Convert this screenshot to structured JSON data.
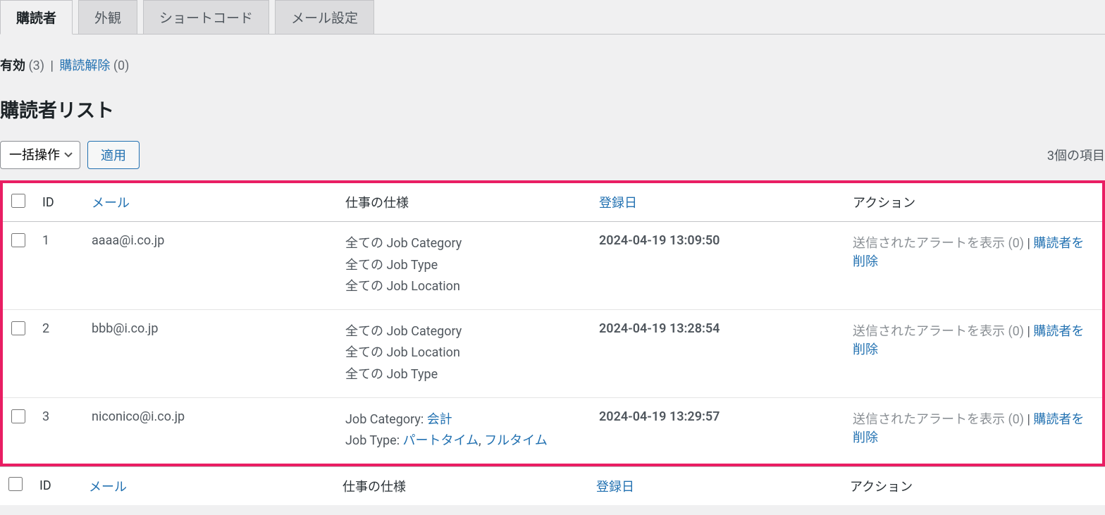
{
  "tabs": {
    "items": [
      {
        "label": "購読者",
        "active": true
      },
      {
        "label": "外観",
        "active": false
      },
      {
        "label": "ショートコード",
        "active": false
      },
      {
        "label": "メール設定",
        "active": false
      }
    ]
  },
  "status_filter": {
    "active_label": "有効",
    "active_count": "(3)",
    "divider": "|",
    "unsub_label": "購読解除",
    "unsub_count": "(0)"
  },
  "page_title": "購読者リスト",
  "toolbar": {
    "bulk_placeholder": "一括操作",
    "apply_label": "適用",
    "item_count": "3個の項目"
  },
  "table": {
    "headers": {
      "id": "ID",
      "email": "メール",
      "spec": "仕事の仕様",
      "date": "登録日",
      "action": "アクション"
    },
    "rows": [
      {
        "id": "1",
        "email": "aaaa@i.co.jp",
        "spec": [
          {
            "text": "全ての Job Category"
          },
          {
            "text": "全ての Job Type"
          },
          {
            "text": "全ての Job Location"
          }
        ],
        "date": "2024-04-19 13:09:50",
        "action_prefix": "送信されたアラートを表示 (0)",
        "action_divider": " | ",
        "action_link": "購読者を削除"
      },
      {
        "id": "2",
        "email": "bbb@i.co.jp",
        "spec": [
          {
            "text": "全ての Job Category"
          },
          {
            "text": "全ての Job Location"
          },
          {
            "text": "全ての Job Type"
          }
        ],
        "date": "2024-04-19 13:28:54",
        "action_prefix": "送信されたアラートを表示 (0)",
        "action_divider": " | ",
        "action_link": "購読者を削除"
      },
      {
        "id": "3",
        "email": "niconico@i.co.jp",
        "spec": [
          {
            "prefix": "Job Category: ",
            "links": [
              "会計"
            ]
          },
          {
            "prefix": "Job Type: ",
            "links": [
              "パートタイム",
              "フルタイム"
            ]
          }
        ],
        "date": "2024-04-19 13:29:57",
        "action_prefix": "送信されたアラートを表示 (0)",
        "action_divider": " | ",
        "action_link": "購読者を削除"
      }
    ]
  }
}
